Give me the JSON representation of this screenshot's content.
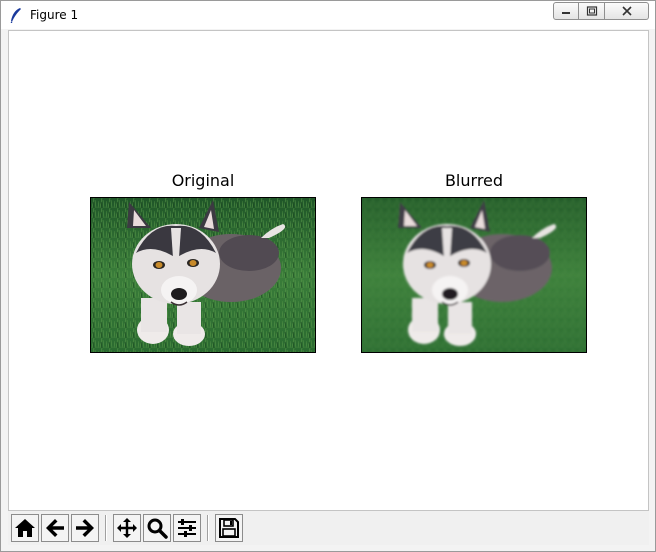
{
  "window": {
    "title": "Figure 1",
    "controls": [
      "minimize-icon",
      "restore-icon",
      "close-icon"
    ]
  },
  "figure": {
    "axes": [
      {
        "title": "Original",
        "image": "husky-puppy-photo",
        "blurred": false
      },
      {
        "title": "Blurred",
        "image": "husky-puppy-photo",
        "blurred": true
      }
    ]
  },
  "toolbar": {
    "buttons": [
      {
        "icon": "home-icon",
        "action": "home"
      },
      {
        "icon": "back-arrow-icon",
        "action": "back"
      },
      {
        "icon": "forward-arrow-icon",
        "action": "forward"
      },
      {
        "icon": "pan-move-icon",
        "action": "pan"
      },
      {
        "icon": "zoom-magnifier-icon",
        "action": "zoom"
      },
      {
        "icon": "configure-subplots-icon",
        "action": "subplots"
      },
      {
        "icon": "save-floppy-icon",
        "action": "save"
      }
    ]
  },
  "colors": {
    "grass": "#2f6b34",
    "grass_dark": "#1d4a24",
    "fur_dark": "#3a3a40",
    "fur_light": "#f2f0f0",
    "eye": "#c88a2a"
  }
}
